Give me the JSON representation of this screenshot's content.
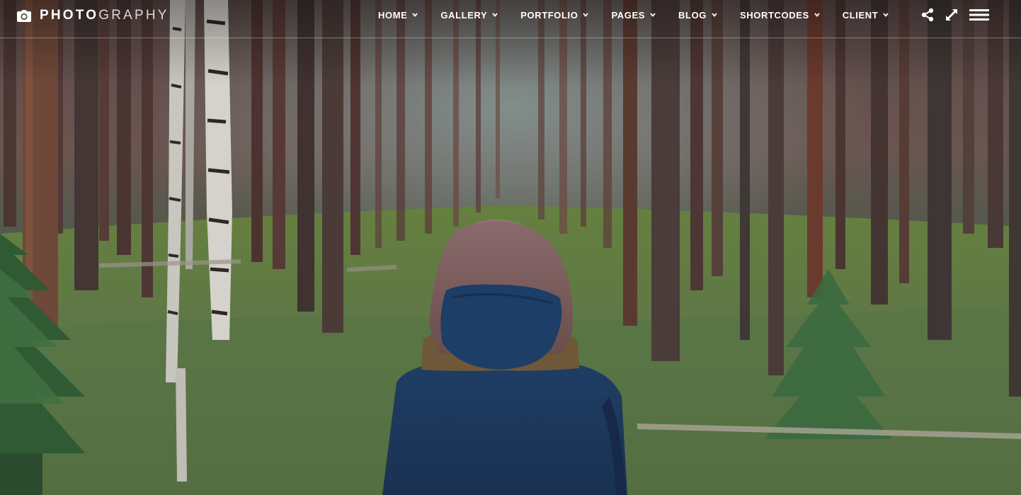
{
  "logo": {
    "text_bold": "PHOTO",
    "text_light": "GRAPHY",
    "icon": "camera-icon"
  },
  "nav": {
    "items": [
      {
        "label": "HOME",
        "icon": "chevron-down-icon"
      },
      {
        "label": "GALLERY",
        "icon": "chevron-down-icon"
      },
      {
        "label": "PORTFOLIO",
        "icon": "chevron-down-icon"
      },
      {
        "label": "PAGES",
        "icon": "chevron-down-icon"
      },
      {
        "label": "BLOG",
        "icon": "chevron-down-icon"
      },
      {
        "label": "SHORTCODES",
        "icon": "chevron-down-icon"
      },
      {
        "label": "CLIENT",
        "icon": "chevron-down-icon"
      }
    ]
  },
  "tools": {
    "share_icon": "share-icon",
    "fullscreen_icon": "expand-icon",
    "menu_icon": "hamburger-menu-icon"
  },
  "hero": {
    "image": "person-in-blue-hood-in-pine-forest"
  },
  "colors": {
    "nav_text": "#ffffff",
    "divider": "rgba(255,255,255,0.35)",
    "jacket": "#1f3a5c",
    "forest_floor": "#55703e"
  }
}
